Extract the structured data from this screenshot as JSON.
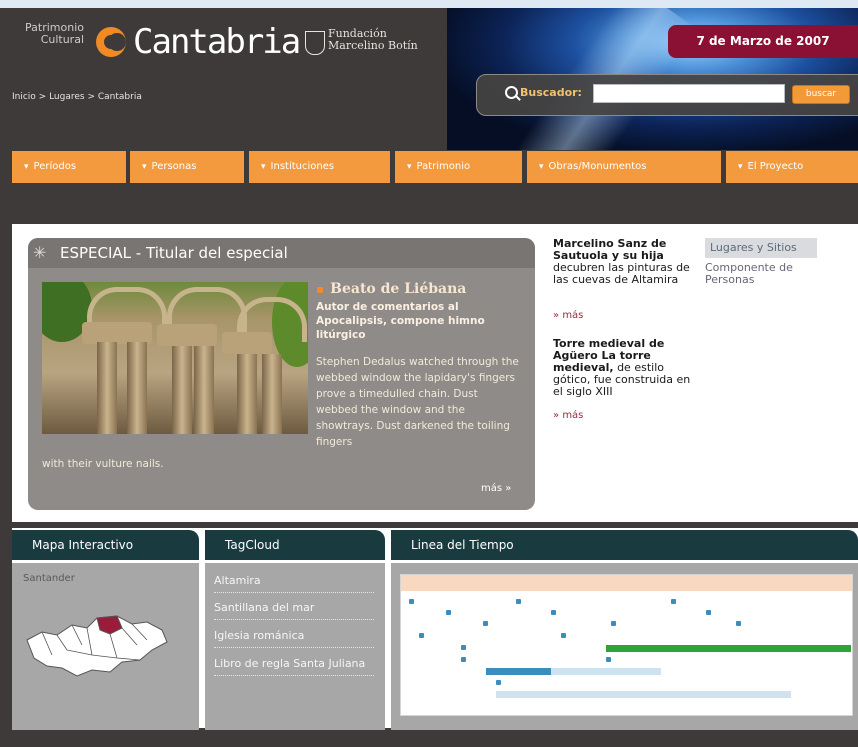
{
  "header": {
    "logo_patrimonio": "Patrimonio\nCultural",
    "logo_cantabria": "Cantabria",
    "fundacion": "Fundación\nMarcelino Botín",
    "breadcrumb": "Inicio > Lugares > Cantabria",
    "date": "7 de Marzo de 2007",
    "search_label": "Buscador:",
    "search_value": "",
    "search_button": "buscar"
  },
  "nav": {
    "items": [
      "Períodos",
      "Personas",
      "Instituciones",
      "Patrimonio",
      "Obras/Monumentos",
      "El Proyecto"
    ]
  },
  "especial": {
    "title": "ESPECIAL - Titular del especial",
    "article_title": "Beato de Liébana",
    "article_subtitle": "Autor de comentarios al Apocalipsis, compone himno litúrgico",
    "body": "Stephen Dedalus watched through the webbed window the lapidary's fingers prove a timedulled chain. Dust webbed the window and the showtrays. Dust darkened the toiling fingers",
    "body_tail": "with their vulture nails.",
    "more": "más"
  },
  "news": [
    {
      "bold": "Marcelino Sanz de Sautuola y su hija",
      "text": "decubren las pinturas de las cuevas de Altamira",
      "more": "más"
    },
    {
      "bold": "Torre medieval de Agüero La torre medieval,",
      "text": "de estilo gótico, fue construida en el siglo XIII",
      "more": "más"
    }
  ],
  "side": {
    "lugares": "Lugares y Sitios",
    "componente": "Componente de Personas"
  },
  "panels": {
    "mapa": {
      "title": "Mapa Interactivo",
      "label": "Santander"
    },
    "tagcloud": {
      "title": "TagCloud",
      "items": [
        "Altamira",
        "Santillana del mar",
        "Iglesia románica",
        "Libro de regla Santa Juliana"
      ]
    },
    "timeline": {
      "title": "Linea del Tiempo"
    }
  },
  "colors": {
    "accent_orange": "#f39a3f",
    "date_red": "#8a1034",
    "panel_teal": "#193b3f"
  }
}
